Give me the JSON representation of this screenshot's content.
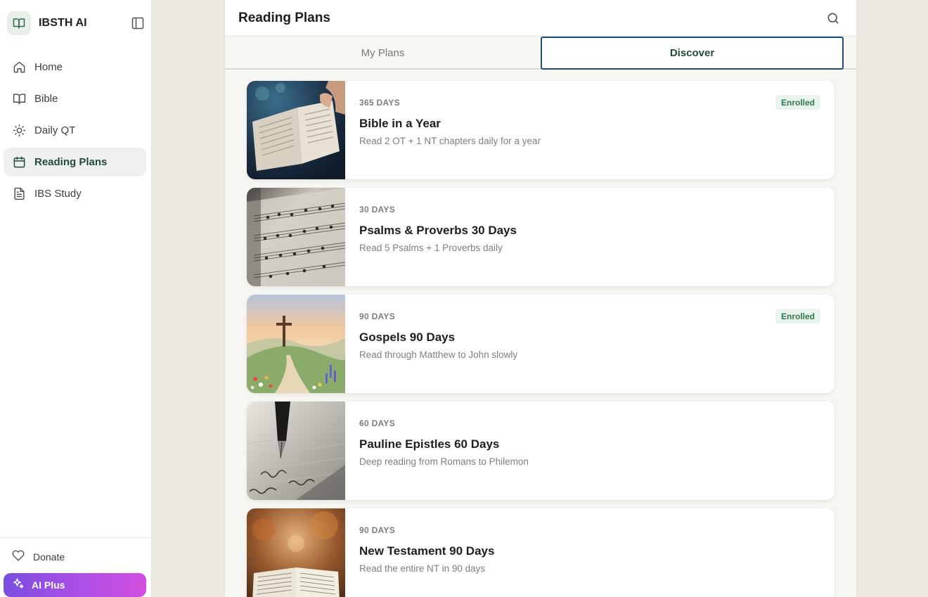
{
  "app": {
    "name": "IBSTH AI"
  },
  "sidebar": {
    "items": [
      {
        "label": "Home",
        "icon": "home-icon"
      },
      {
        "label": "Bible",
        "icon": "book-icon"
      },
      {
        "label": "Daily QT",
        "icon": "sun-icon"
      },
      {
        "label": "Reading Plans",
        "icon": "calendar-icon",
        "active": true
      },
      {
        "label": "IBS Study",
        "icon": "document-icon"
      }
    ],
    "donate_label": "Donate",
    "ai_plus_label": "AI Plus"
  },
  "header": {
    "title": "Reading Plans"
  },
  "tabs": [
    {
      "label": "My Plans",
      "active": false
    },
    {
      "label": "Discover",
      "active": true
    }
  ],
  "plans": [
    {
      "days": "365 DAYS",
      "title": "Bible in a Year",
      "description": "Read 2 OT + 1 NT chapters daily for a year",
      "badge": "Enrolled",
      "image": "open-bible-hand"
    },
    {
      "days": "30 DAYS",
      "title": "Psalms & Proverbs 30 Days",
      "description": "Read 5 Psalms + 1 Proverbs daily",
      "badge": "",
      "image": "hymn-sheet-music"
    },
    {
      "days": "90 DAYS",
      "title": "Gospels 90 Days",
      "description": "Read through Matthew to John slowly",
      "badge": "Enrolled",
      "image": "cross-on-hill-painting"
    },
    {
      "days": "60 DAYS",
      "title": "Pauline Epistles 60 Days",
      "description": "Deep reading from Romans to Philemon",
      "badge": "",
      "image": "fountain-pen-writing"
    },
    {
      "days": "90 DAYS",
      "title": "New Testament 90 Days",
      "description": "Read the entire NT in 90 days",
      "badge": "",
      "image": "open-bible-autumn"
    }
  ],
  "colors": {
    "accent": "#234a38",
    "tab_border": "#1f4e7a",
    "enrolled_bg": "#eaf4ec",
    "enrolled_text": "#2f7a4a",
    "ai_plus_gradient": [
      "#7a4ee0",
      "#d24fe0"
    ]
  }
}
